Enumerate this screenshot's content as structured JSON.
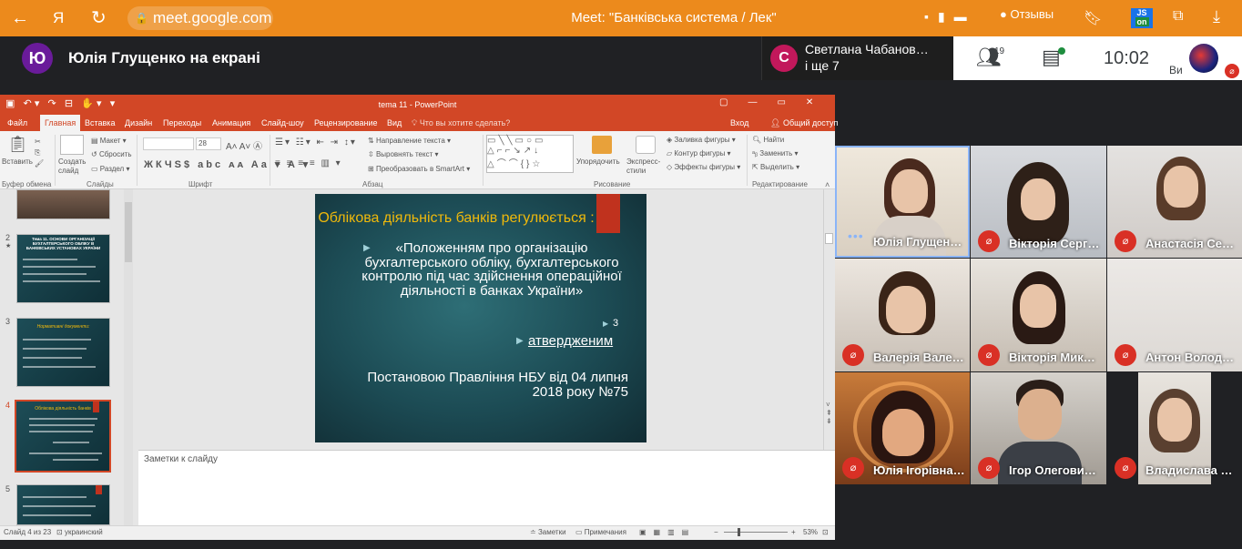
{
  "browser": {
    "url": "meet.google.com",
    "page_title": "Meet: \"Банківська система / Лек\"",
    "reviews": "Отзывы",
    "js_badge_top": "JS",
    "js_badge_bottom": "on",
    "brand_color": "#ec8a1c"
  },
  "meet": {
    "presenter_initial": "Ю",
    "presenter_label": "Юлія Глущенко на екрані",
    "card_initial": "С",
    "card_name": "Светлана Чабанов…",
    "card_more": "і ще 7",
    "people_count": "19",
    "clock": "10:02",
    "self_label": "Ви"
  },
  "ppt": {
    "window_title": "tema 11 - PowerPoint",
    "tabs": [
      "Файл",
      "Главная",
      "Вставка",
      "Дизайн",
      "Переходы",
      "Анимация",
      "Слайд-шоу",
      "Рецензирование",
      "Вид"
    ],
    "tell_me": "Что вы хотите сделать?",
    "signin": "Вход",
    "share": "Общий доступ",
    "ribbon": {
      "paste": "Вставить",
      "create_slide": "Создать слайд",
      "layout": "Макет",
      "reset": "Сбросить",
      "section": "Раздел",
      "font_size": "28",
      "text_direction": "Направление текста",
      "align_text": "Выровнять текст",
      "smartart": "Преобразовать в SmartArt",
      "arrange": "Упорядочить",
      "quick_styles": "Экспресс-стили",
      "fill": "Заливка фигуры",
      "outline": "Контур фигуры",
      "effects": "Эффекты фигуры",
      "find": "Найти",
      "replace": "Заменить",
      "select": "Выделить",
      "groups": {
        "clipboard": "Буфер обмена",
        "slides": "Слайды",
        "font": "Шрифт",
        "paragraph": "Абзац",
        "drawing": "Рисование",
        "editing": "Редактирование"
      }
    },
    "thumbs": [
      {
        "num": "2",
        "title": "Тема 11. ОСНОВИ ОРГАНІЗАЦІЇ БУХГАЛТЕРСЬКОГО ОБЛІКУ В БАНКІВСЬКИХ УСТАНОВАХ УКРАЇНИ"
      },
      {
        "num": "3",
        "title": "Нормативні документи:"
      },
      {
        "num": "4",
        "title": "Облікова діяльність банків"
      },
      {
        "num": "5",
        "title": ""
      }
    ],
    "slide": {
      "title": "Облікова діяльність банків регулюється :",
      "body": "«Положенням про організацію бухгалтерського обліку, бухгалтерського контролю  під час здійснення операційної діяльності в банках України»",
      "item_number": "3",
      "approved": "атвердженим",
      "decree": "Постановою Правління НБУ від 04 липня 2018 року №75"
    },
    "notes_placeholder": "Заметки к слайду",
    "status": {
      "slide_count": "Слайд 4 из 23",
      "language": "украинский",
      "notes": "Заметки",
      "comments": "Примечания",
      "zoom": "53%"
    }
  },
  "participants": [
    {
      "name": "Юлія Глущен…",
      "muted": false,
      "speaking": true
    },
    {
      "name": "Вікторія Серг…",
      "muted": true
    },
    {
      "name": "Анастасія Се…",
      "muted": true
    },
    {
      "name": "Валерія Вале…",
      "muted": true
    },
    {
      "name": "Вікторія Мик…",
      "muted": true
    },
    {
      "name": "Антон Волод…",
      "muted": true
    },
    {
      "name": "Юлія Ігорівна…",
      "muted": true
    },
    {
      "name": "Ігор Олегови…",
      "muted": true
    },
    {
      "name": "Владислава …",
      "muted": true
    }
  ]
}
